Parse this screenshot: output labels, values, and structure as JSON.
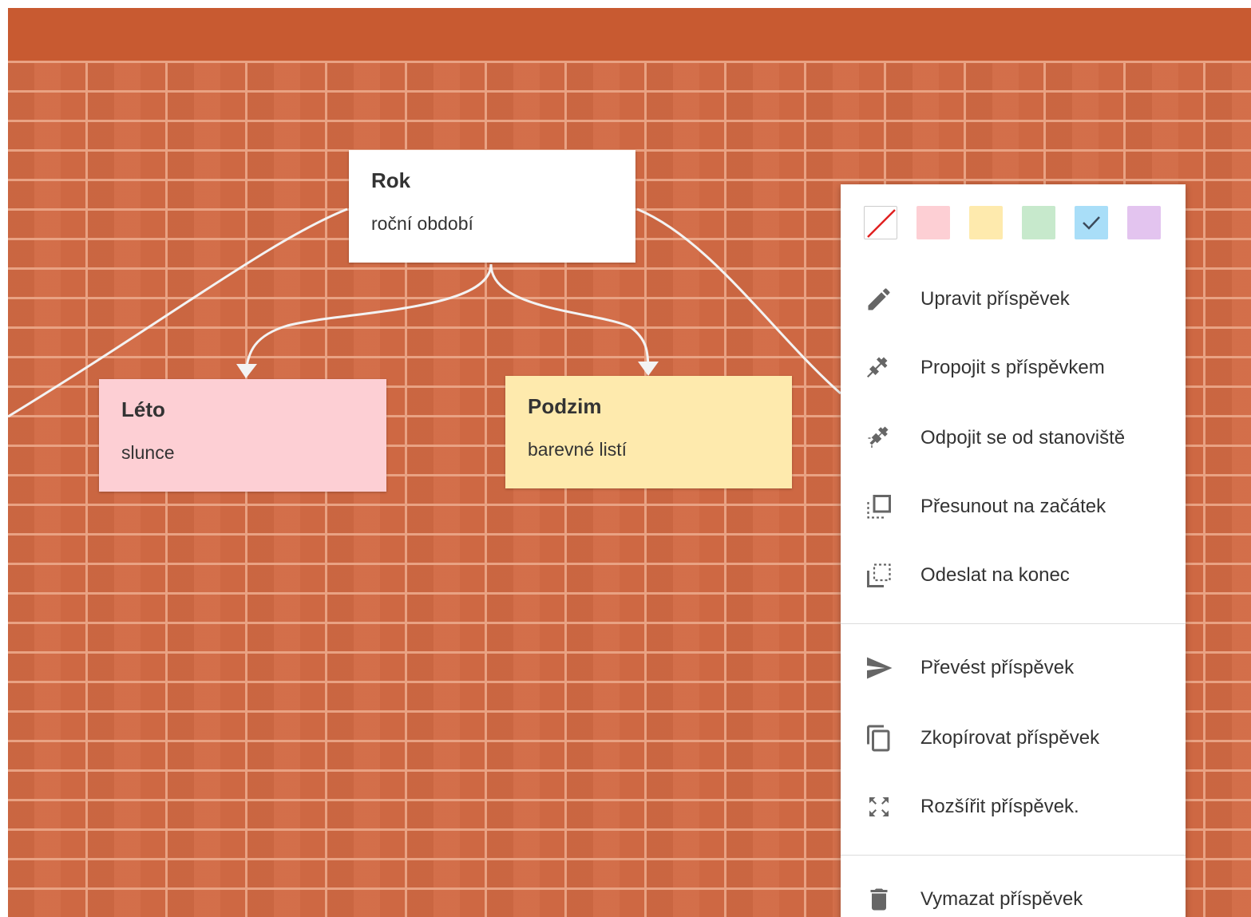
{
  "posts": {
    "rok": {
      "title": "Rok",
      "body": "roční období",
      "color": "#ffffff"
    },
    "leto": {
      "title": "Léto",
      "body": "slunce",
      "color": "#fdcfd4"
    },
    "podzim": {
      "title": "Podzim",
      "body": "barevné listí",
      "color": "#feeaad"
    }
  },
  "colors": {
    "topbar": "#c85a31",
    "brick": "#d26a44",
    "mortar": "#e9a283"
  },
  "context_menu": {
    "swatches": [
      {
        "name": "none",
        "color": "#ffffff"
      },
      {
        "name": "pink",
        "color": "#fdcfd4"
      },
      {
        "name": "yellow",
        "color": "#feeaad"
      },
      {
        "name": "green",
        "color": "#c7e9cc"
      },
      {
        "name": "blue",
        "color": "#a9def8",
        "selected": true
      },
      {
        "name": "purple",
        "color": "#e3c4ef"
      }
    ],
    "items": [
      {
        "label": "Upravit příspěvek",
        "icon": "pencil-icon"
      },
      {
        "label": "Propojit s příspěvkem",
        "icon": "plug-icon"
      },
      {
        "label": "Odpojit se od stanoviště",
        "icon": "unplug-icon"
      },
      {
        "label": "Přesunout na začátek",
        "icon": "bring-to-front-icon"
      },
      {
        "label": "Odeslat na konec",
        "icon": "send-to-back-icon"
      },
      {
        "label": "Převést příspěvek",
        "icon": "send-icon"
      },
      {
        "label": "Zkopírovat příspěvek",
        "icon": "copy-icon"
      },
      {
        "label": "Rozšířit příspěvek.",
        "icon": "expand-icon"
      },
      {
        "label": "Vymazat příspěvek",
        "icon": "trash-icon"
      }
    ]
  }
}
